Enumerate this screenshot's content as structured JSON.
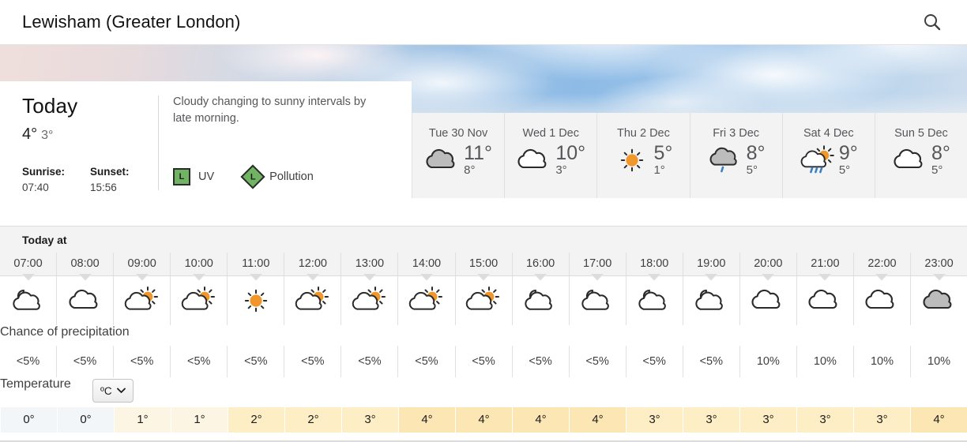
{
  "search": {
    "value": "Lewisham (Greater London)",
    "icon": "search-icon"
  },
  "today": {
    "title": "Today",
    "high": "4°",
    "low": "3°",
    "sunrise_label": "Sunrise:",
    "sunrise_time": "07:40",
    "sunset_label": "Sunset:",
    "sunset_time": "15:56",
    "description": "Cloudy changing to sunny intervals by late morning.",
    "uv": {
      "level": "L",
      "label": "UV"
    },
    "pollution": {
      "level": "L",
      "label": "Pollution"
    }
  },
  "daily": [
    {
      "name": "Tue 30 Nov",
      "icon": "overcast-cloud-icon",
      "high": "11°",
      "low": "8°"
    },
    {
      "name": "Wed 1 Dec",
      "icon": "cloud-icon",
      "high": "10°",
      "low": "3°"
    },
    {
      "name": "Thu 2 Dec",
      "icon": "sun-icon",
      "high": "5°",
      "low": "1°"
    },
    {
      "name": "Fri 3 Dec",
      "icon": "light-rain-icon",
      "high": "8°",
      "low": "5°"
    },
    {
      "name": "Sat 4 Dec",
      "icon": "sun-cloud-rain-icon",
      "high": "9°",
      "low": "5°"
    },
    {
      "name": "Sun 5 Dec",
      "icon": "cloud-icon",
      "high": "8°",
      "low": "5°"
    }
  ],
  "hourly": {
    "title": "Today at",
    "precip_label": "Chance of precipitation",
    "temp_label": "Temperature",
    "unit": "ºC",
    "times": [
      "07:00",
      "08:00",
      "09:00",
      "10:00",
      "11:00",
      "12:00",
      "13:00",
      "14:00",
      "15:00",
      "16:00",
      "17:00",
      "18:00",
      "19:00",
      "20:00",
      "21:00",
      "22:00",
      "23:00"
    ],
    "icons": [
      "moon-cloud-icon",
      "cloud-icon",
      "sun-cloud-icon",
      "sun-cloud-icon",
      "sun-icon",
      "sun-cloud-icon",
      "sun-cloud-icon",
      "sun-cloud-icon",
      "sun-cloud-icon",
      "moon-cloud-icon",
      "moon-cloud-icon",
      "moon-cloud-icon",
      "moon-cloud-icon",
      "cloud-icon",
      "cloud-icon",
      "cloud-icon",
      "overcast-cloud-icon"
    ],
    "precip": [
      "<5%",
      "<5%",
      "<5%",
      "<5%",
      "<5%",
      "<5%",
      "<5%",
      "<5%",
      "<5%",
      "<5%",
      "<5%",
      "<5%",
      "<5%",
      "10%",
      "10%",
      "10%",
      "10%"
    ],
    "temps": [
      "0°",
      "0°",
      "1°",
      "1°",
      "2°",
      "2°",
      "3°",
      "4°",
      "4°",
      "4°",
      "4°",
      "3°",
      "3°",
      "3°",
      "3°",
      "3°",
      "4°"
    ],
    "temp_colors": [
      "#f2f6f9",
      "#f2f6f9",
      "#fdf5e3",
      "#fdf5e3",
      "#fdeec6",
      "#fdeec6",
      "#fdeec6",
      "#fce7b4",
      "#fce7b4",
      "#fce7b4",
      "#fce7b4",
      "#fdeec6",
      "#fdeec6",
      "#fdeec6",
      "#fdeec6",
      "#fdeec6",
      "#fce7b4"
    ]
  },
  "colors": {
    "accent_sun": "#f0962a",
    "badge_green": "#70b363",
    "rain_blue": "#3e7fc1"
  }
}
